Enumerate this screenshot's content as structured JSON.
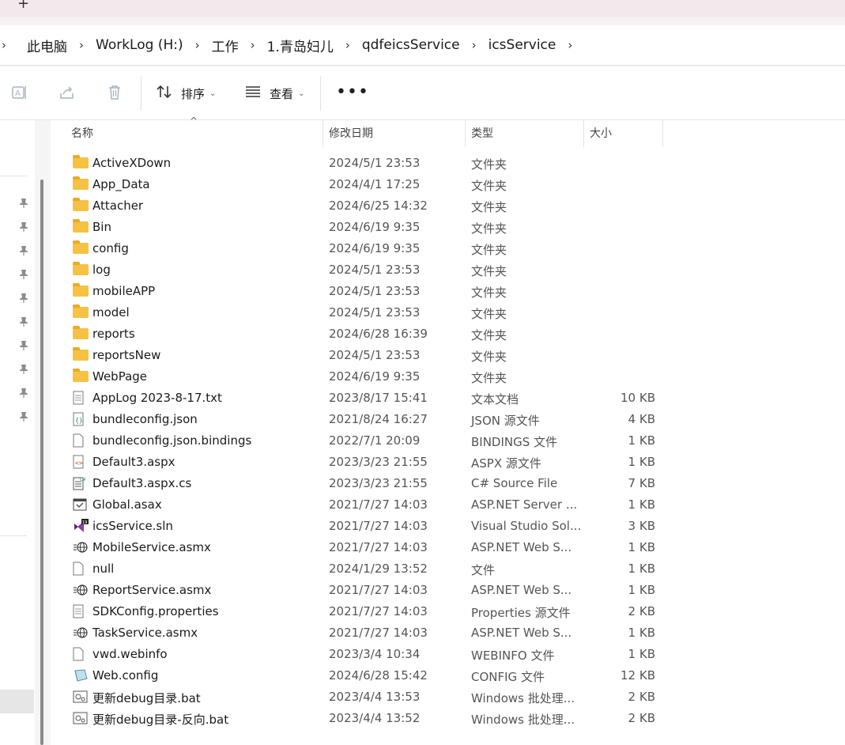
{
  "tabbar": {
    "new_tab": "+"
  },
  "breadcrumb": [
    "此电脑",
    "WorkLog (H:)",
    "工作",
    "1.青岛妇儿",
    "qdfeicsService",
    "icsService"
  ],
  "toolbar": {
    "sort_label": "排序",
    "view_label": "查看",
    "more_label": "•••"
  },
  "columns": {
    "name": "名称",
    "date": "修改日期",
    "type": "类型",
    "size": "大小"
  },
  "files": [
    {
      "name": "ActiveXDown",
      "date": "2024/5/1 23:53",
      "type": "文件夹",
      "size": "",
      "icon": "folder-icon"
    },
    {
      "name": "App_Data",
      "date": "2024/4/1 17:25",
      "type": "文件夹",
      "size": "",
      "icon": "folder-icon"
    },
    {
      "name": "Attacher",
      "date": "2024/6/25 14:32",
      "type": "文件夹",
      "size": "",
      "icon": "folder-icon"
    },
    {
      "name": "Bin",
      "date": "2024/6/19 9:35",
      "type": "文件夹",
      "size": "",
      "icon": "folder-icon"
    },
    {
      "name": "config",
      "date": "2024/6/19 9:35",
      "type": "文件夹",
      "size": "",
      "icon": "folder-icon"
    },
    {
      "name": "log",
      "date": "2024/5/1 23:53",
      "type": "文件夹",
      "size": "",
      "icon": "folder-icon"
    },
    {
      "name": "mobileAPP",
      "date": "2024/5/1 23:53",
      "type": "文件夹",
      "size": "",
      "icon": "folder-icon"
    },
    {
      "name": "model",
      "date": "2024/5/1 23:53",
      "type": "文件夹",
      "size": "",
      "icon": "folder-icon"
    },
    {
      "name": "reports",
      "date": "2024/6/28 16:39",
      "type": "文件夹",
      "size": "",
      "icon": "folder-icon"
    },
    {
      "name": "reportsNew",
      "date": "2024/5/1 23:53",
      "type": "文件夹",
      "size": "",
      "icon": "folder-icon"
    },
    {
      "name": "WebPage",
      "date": "2024/6/19 9:35",
      "type": "文件夹",
      "size": "",
      "icon": "folder-icon"
    },
    {
      "name": "AppLog 2023-8-17.txt",
      "date": "2023/8/17 15:41",
      "type": "文本文档",
      "size": "10 KB",
      "icon": "text-file-icon"
    },
    {
      "name": "bundleconfig.json",
      "date": "2021/8/24 16:27",
      "type": "JSON 源文件",
      "size": "4 KB",
      "icon": "json-file-icon"
    },
    {
      "name": "bundleconfig.json.bindings",
      "date": "2022/7/1 20:09",
      "type": "BINDINGS 文件",
      "size": "1 KB",
      "icon": "file-icon"
    },
    {
      "name": "Default3.aspx",
      "date": "2023/3/23 21:55",
      "type": "ASPX 源文件",
      "size": "1 KB",
      "icon": "code-file-icon"
    },
    {
      "name": "Default3.aspx.cs",
      "date": "2023/3/23 21:55",
      "type": "C# Source File",
      "size": "7 KB",
      "icon": "csharp-file-icon"
    },
    {
      "name": "Global.asax",
      "date": "2021/7/27 14:03",
      "type": "ASP.NET Server ...",
      "size": "1 KB",
      "icon": "asax-file-icon"
    },
    {
      "name": "icsService.sln",
      "date": "2021/7/27 14:03",
      "type": "Visual Studio Sol...",
      "size": "3 KB",
      "icon": "visual-studio-icon"
    },
    {
      "name": "MobileService.asmx",
      "date": "2021/7/27 14:03",
      "type": "ASP.NET Web S...",
      "size": "1 KB",
      "icon": "web-service-icon"
    },
    {
      "name": "null",
      "date": "2024/1/29 13:52",
      "type": "文件",
      "size": "1 KB",
      "icon": "file-icon"
    },
    {
      "name": "ReportService.asmx",
      "date": "2021/7/27 14:03",
      "type": "ASP.NET Web S...",
      "size": "1 KB",
      "icon": "web-service-icon"
    },
    {
      "name": "SDKConfig.properties",
      "date": "2021/7/27 14:03",
      "type": "Properties 源文件",
      "size": "2 KB",
      "icon": "text-file-icon"
    },
    {
      "name": "TaskService.asmx",
      "date": "2021/7/27 14:03",
      "type": "ASP.NET Web S...",
      "size": "1 KB",
      "icon": "web-service-icon"
    },
    {
      "name": "vwd.webinfo",
      "date": "2023/3/4 10:34",
      "type": "WEBINFO 文件",
      "size": "1 KB",
      "icon": "file-icon"
    },
    {
      "name": "Web.config",
      "date": "2024/6/28 15:42",
      "type": "CONFIG 文件",
      "size": "12 KB",
      "icon": "config-file-icon"
    },
    {
      "name": "更新debug目录.bat",
      "date": "2023/4/4 13:53",
      "type": "Windows 批处理...",
      "size": "2 KB",
      "icon": "batch-file-icon"
    },
    {
      "name": "更新debug目录-反向.bat",
      "date": "2023/4/4 13:52",
      "type": "Windows 批处理...",
      "size": "2 KB",
      "icon": "batch-file-icon"
    }
  ]
}
